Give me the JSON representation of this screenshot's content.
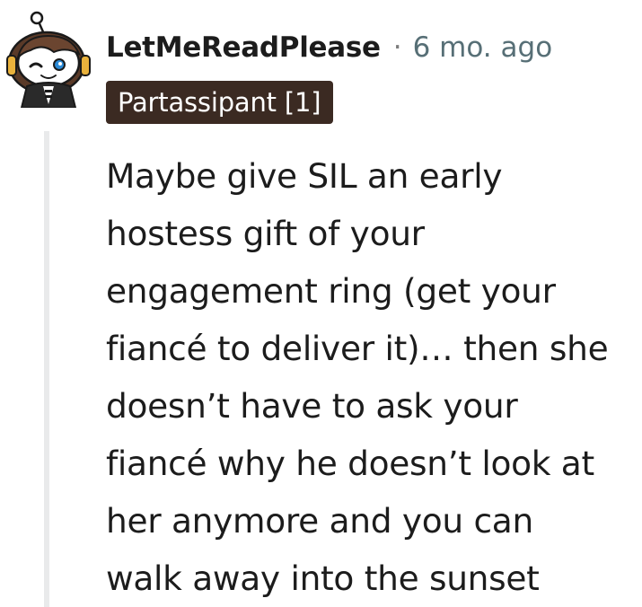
{
  "comment": {
    "author": "LetMeReadPlease",
    "separator": "·",
    "timestamp": "6 mo. ago",
    "flair": "Partassipant [1]",
    "avatar_icon": "snoo-avatar-icon",
    "body_lines": [
      "Maybe give SIL an early",
      "hostess gift of your",
      "engagement ring (get your",
      "fiancé to deliver it)… then she",
      "doesn’t have to ask your",
      "fiancé why he doesn’t look at",
      "her anymore and you can",
      "walk away into the sunset"
    ]
  },
  "colors": {
    "flair_background": "#3b2a22",
    "flair_text": "#ffffff",
    "username": "#1c1c1c",
    "timestamp": "#576f76",
    "thread_line": "#e9eaeb",
    "body_text": "#1c1c1c"
  }
}
